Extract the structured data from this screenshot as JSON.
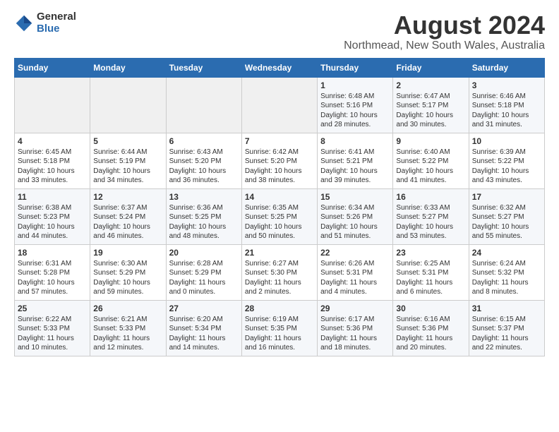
{
  "logo": {
    "general": "General",
    "blue": "Blue"
  },
  "header": {
    "title": "August 2024",
    "subtitle": "Northmead, New South Wales, Australia"
  },
  "weekdays": [
    "Sunday",
    "Monday",
    "Tuesday",
    "Wednesday",
    "Thursday",
    "Friday",
    "Saturday"
  ],
  "weeks": [
    [
      {
        "day": "",
        "info": ""
      },
      {
        "day": "",
        "info": ""
      },
      {
        "day": "",
        "info": ""
      },
      {
        "day": "",
        "info": ""
      },
      {
        "day": "1",
        "info": "Sunrise: 6:48 AM\nSunset: 5:16 PM\nDaylight: 10 hours\nand 28 minutes."
      },
      {
        "day": "2",
        "info": "Sunrise: 6:47 AM\nSunset: 5:17 PM\nDaylight: 10 hours\nand 30 minutes."
      },
      {
        "day": "3",
        "info": "Sunrise: 6:46 AM\nSunset: 5:18 PM\nDaylight: 10 hours\nand 31 minutes."
      }
    ],
    [
      {
        "day": "4",
        "info": "Sunrise: 6:45 AM\nSunset: 5:18 PM\nDaylight: 10 hours\nand 33 minutes."
      },
      {
        "day": "5",
        "info": "Sunrise: 6:44 AM\nSunset: 5:19 PM\nDaylight: 10 hours\nand 34 minutes."
      },
      {
        "day": "6",
        "info": "Sunrise: 6:43 AM\nSunset: 5:20 PM\nDaylight: 10 hours\nand 36 minutes."
      },
      {
        "day": "7",
        "info": "Sunrise: 6:42 AM\nSunset: 5:20 PM\nDaylight: 10 hours\nand 38 minutes."
      },
      {
        "day": "8",
        "info": "Sunrise: 6:41 AM\nSunset: 5:21 PM\nDaylight: 10 hours\nand 39 minutes."
      },
      {
        "day": "9",
        "info": "Sunrise: 6:40 AM\nSunset: 5:22 PM\nDaylight: 10 hours\nand 41 minutes."
      },
      {
        "day": "10",
        "info": "Sunrise: 6:39 AM\nSunset: 5:22 PM\nDaylight: 10 hours\nand 43 minutes."
      }
    ],
    [
      {
        "day": "11",
        "info": "Sunrise: 6:38 AM\nSunset: 5:23 PM\nDaylight: 10 hours\nand 44 minutes."
      },
      {
        "day": "12",
        "info": "Sunrise: 6:37 AM\nSunset: 5:24 PM\nDaylight: 10 hours\nand 46 minutes."
      },
      {
        "day": "13",
        "info": "Sunrise: 6:36 AM\nSunset: 5:25 PM\nDaylight: 10 hours\nand 48 minutes."
      },
      {
        "day": "14",
        "info": "Sunrise: 6:35 AM\nSunset: 5:25 PM\nDaylight: 10 hours\nand 50 minutes."
      },
      {
        "day": "15",
        "info": "Sunrise: 6:34 AM\nSunset: 5:26 PM\nDaylight: 10 hours\nand 51 minutes."
      },
      {
        "day": "16",
        "info": "Sunrise: 6:33 AM\nSunset: 5:27 PM\nDaylight: 10 hours\nand 53 minutes."
      },
      {
        "day": "17",
        "info": "Sunrise: 6:32 AM\nSunset: 5:27 PM\nDaylight: 10 hours\nand 55 minutes."
      }
    ],
    [
      {
        "day": "18",
        "info": "Sunrise: 6:31 AM\nSunset: 5:28 PM\nDaylight: 10 hours\nand 57 minutes."
      },
      {
        "day": "19",
        "info": "Sunrise: 6:30 AM\nSunset: 5:29 PM\nDaylight: 10 hours\nand 59 minutes."
      },
      {
        "day": "20",
        "info": "Sunrise: 6:28 AM\nSunset: 5:29 PM\nDaylight: 11 hours\nand 0 minutes."
      },
      {
        "day": "21",
        "info": "Sunrise: 6:27 AM\nSunset: 5:30 PM\nDaylight: 11 hours\nand 2 minutes."
      },
      {
        "day": "22",
        "info": "Sunrise: 6:26 AM\nSunset: 5:31 PM\nDaylight: 11 hours\nand 4 minutes."
      },
      {
        "day": "23",
        "info": "Sunrise: 6:25 AM\nSunset: 5:31 PM\nDaylight: 11 hours\nand 6 minutes."
      },
      {
        "day": "24",
        "info": "Sunrise: 6:24 AM\nSunset: 5:32 PM\nDaylight: 11 hours\nand 8 minutes."
      }
    ],
    [
      {
        "day": "25",
        "info": "Sunrise: 6:22 AM\nSunset: 5:33 PM\nDaylight: 11 hours\nand 10 minutes."
      },
      {
        "day": "26",
        "info": "Sunrise: 6:21 AM\nSunset: 5:33 PM\nDaylight: 11 hours\nand 12 minutes."
      },
      {
        "day": "27",
        "info": "Sunrise: 6:20 AM\nSunset: 5:34 PM\nDaylight: 11 hours\nand 14 minutes."
      },
      {
        "day": "28",
        "info": "Sunrise: 6:19 AM\nSunset: 5:35 PM\nDaylight: 11 hours\nand 16 minutes."
      },
      {
        "day": "29",
        "info": "Sunrise: 6:17 AM\nSunset: 5:36 PM\nDaylight: 11 hours\nand 18 minutes."
      },
      {
        "day": "30",
        "info": "Sunrise: 6:16 AM\nSunset: 5:36 PM\nDaylight: 11 hours\nand 20 minutes."
      },
      {
        "day": "31",
        "info": "Sunrise: 6:15 AM\nSunset: 5:37 PM\nDaylight: 11 hours\nand 22 minutes."
      }
    ]
  ]
}
